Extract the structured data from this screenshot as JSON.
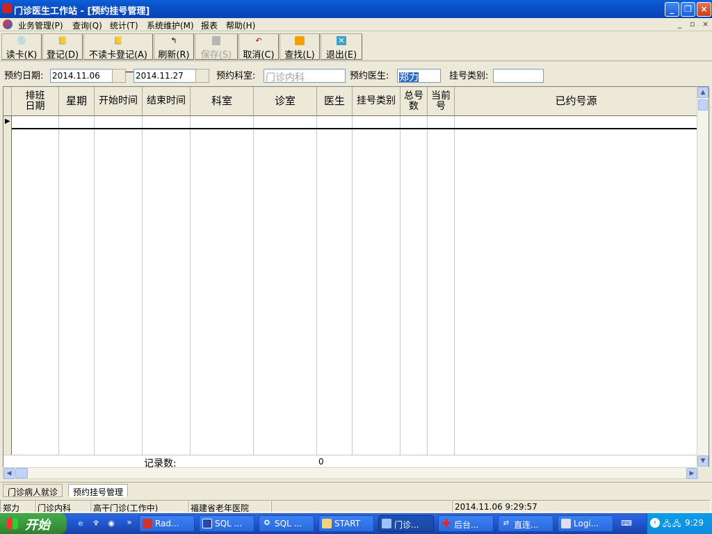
{
  "window": {
    "title": "门诊医生工作站 - [预约挂号管理]"
  },
  "menu": {
    "items": [
      "业务管理(P)",
      "查询(Q)",
      "统计(T)",
      "系统维护(M)",
      "报表",
      "帮助(H)"
    ],
    "mdi_controls": [
      "_",
      "▫",
      "×"
    ]
  },
  "toolbar": {
    "buttons": [
      {
        "label": "读卡(K)",
        "icon": "card-reader-icon"
      },
      {
        "label": "登记(D)",
        "icon": "register-icon"
      },
      {
        "label": "不读卡登记(A)",
        "icon": "register-icon"
      },
      {
        "label": "刷新(R)",
        "icon": "refresh-icon"
      },
      {
        "label": "保存(S)",
        "icon": "save-icon",
        "disabled": true
      },
      {
        "label": "取消(C)",
        "icon": "undo-icon"
      },
      {
        "label": "查找(L)",
        "icon": "eraser-icon"
      },
      {
        "label": "退出(E)",
        "icon": "exit-icon"
      }
    ]
  },
  "filter": {
    "date_label": "预约日期:",
    "date_from": "2014.11.06",
    "date_sep": "—",
    "date_to": "2014.11.27",
    "dept_label": "预约科室:",
    "dept_value": "门诊内科",
    "doctor_label": "预约医生:",
    "doctor_value": "郑力",
    "type_label": "挂号类别:",
    "type_value": ""
  },
  "grid": {
    "columns": [
      "排班日期",
      "星期",
      "开始时间",
      "结束时间",
      "科室",
      "诊室",
      "医生",
      "挂号类别",
      "总号数",
      "当前号",
      "已约号源"
    ],
    "footer_label": "记录数:",
    "footer_count": "0"
  },
  "tabs": [
    "门诊病人就诊",
    "预约挂号管理"
  ],
  "status": {
    "user": "郑力",
    "dept": "门诊内科",
    "clinic": "高干门诊(工作中)",
    "hospital": "福建省老年医院",
    "empty": "",
    "datetime": "2014.11.06 9:29:57"
  },
  "taskbar": {
    "start": "开始",
    "tasks": [
      "Rad...",
      "SQL ...",
      "SQL ...",
      "START",
      "门诊...",
      "后台...",
      "直连...",
      "Logi..."
    ],
    "clock": "9:29"
  }
}
